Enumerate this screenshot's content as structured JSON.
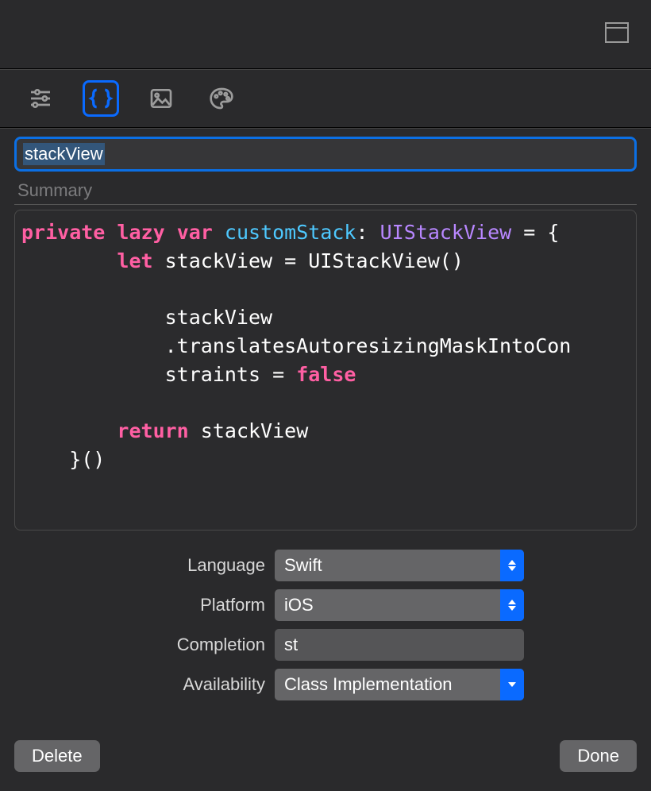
{
  "title_field": {
    "value": "stackView"
  },
  "summary": {
    "placeholder": "Summary"
  },
  "code": {
    "tokens": [
      {
        "t": "private",
        "c": "kw"
      },
      {
        "t": " ",
        "c": "plain"
      },
      {
        "t": "lazy",
        "c": "kw"
      },
      {
        "t": " ",
        "c": "plain"
      },
      {
        "t": "var",
        "c": "kw"
      },
      {
        "t": " ",
        "c": "plain"
      },
      {
        "t": "customStack",
        "c": "name"
      },
      {
        "t": ": ",
        "c": "plain"
      },
      {
        "t": "UIStackView",
        "c": "type"
      },
      {
        "t": " = {\n",
        "c": "plain"
      },
      {
        "t": "        ",
        "c": "plain"
      },
      {
        "t": "let",
        "c": "kw"
      },
      {
        "t": " stackView = UIStackView()\n",
        "c": "plain"
      },
      {
        "t": "\n",
        "c": "plain"
      },
      {
        "t": "            stackView\n",
        "c": "plain"
      },
      {
        "t": "            .translatesAutoresizingMaskIntoCon\n",
        "c": "plain"
      },
      {
        "t": "            straints = ",
        "c": "plain"
      },
      {
        "t": "false",
        "c": "kw"
      },
      {
        "t": "\n",
        "c": "plain"
      },
      {
        "t": "\n",
        "c": "plain"
      },
      {
        "t": "        ",
        "c": "plain"
      },
      {
        "t": "return",
        "c": "kw"
      },
      {
        "t": " stackView\n",
        "c": "plain"
      },
      {
        "t": "    }()",
        "c": "plain"
      }
    ]
  },
  "form": {
    "language": {
      "label": "Language",
      "value": "Swift"
    },
    "platform": {
      "label": "Platform",
      "value": "iOS"
    },
    "completion": {
      "label": "Completion",
      "value": "st"
    },
    "availability": {
      "label": "Availability",
      "value": "Class Implementation"
    }
  },
  "buttons": {
    "delete": "Delete",
    "done": "Done"
  }
}
